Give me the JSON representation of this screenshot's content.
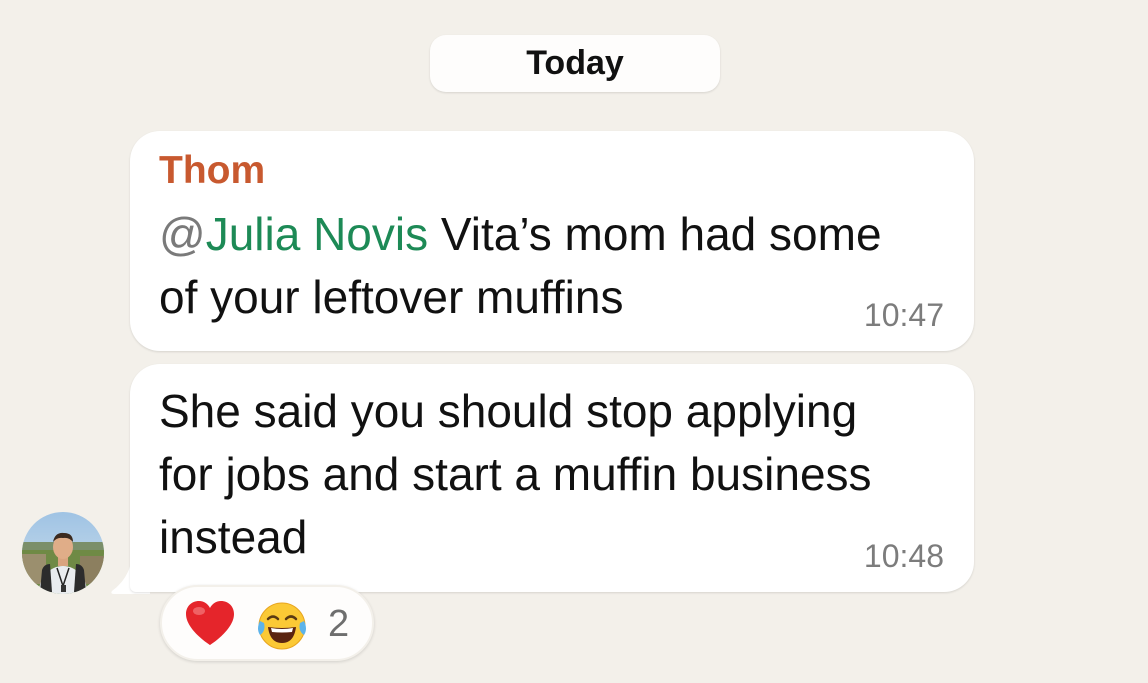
{
  "date_divider": {
    "label": "Today"
  },
  "messages": [
    {
      "sender": "Thom",
      "mention_at": "@",
      "mention_name": "Julia Novis",
      "text_line1_rest": " Vita’s mom had some",
      "text_line2": "of your leftover muffins",
      "time": "10:47"
    },
    {
      "text_line1": "She said you should stop applying",
      "text_line2": "for jobs and start a muffin business",
      "text_line3": "instead",
      "time": "10:48"
    }
  ],
  "reactions": {
    "emojis": [
      "red-heart-icon",
      "laughing-tears-icon"
    ],
    "count": "2"
  },
  "colors": {
    "background": "#f3f0ea",
    "sender": "#c8592f",
    "mention": "#1d8a56",
    "timestamp": "#7c7c7c"
  }
}
